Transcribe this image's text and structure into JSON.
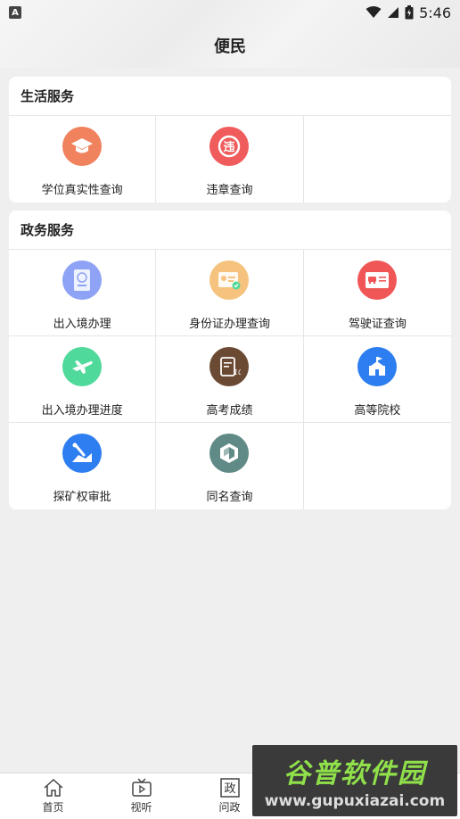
{
  "status_bar": {
    "app_indicator": "A",
    "time": "5:46",
    "icons": [
      "wifi-icon",
      "signal-icon",
      "battery-icon"
    ]
  },
  "header": {
    "title": "便民"
  },
  "sections": [
    {
      "title": "生活服务",
      "items": [
        {
          "label": "学位真实性查询",
          "icon": "graduation-cap-icon",
          "color": "#f0825e"
        },
        {
          "label": "违章查询",
          "icon": "traffic-violation-icon",
          "color": "#f05b5b"
        }
      ]
    },
    {
      "title": "政务服务",
      "items": [
        {
          "label": "出入境办理",
          "icon": "passport-icon",
          "color": "#8ea3f5"
        },
        {
          "label": "身份证办理查询",
          "icon": "id-card-icon",
          "color": "#f5c37d"
        },
        {
          "label": "驾驶证查询",
          "icon": "driver-license-icon",
          "color": "#f05656"
        },
        {
          "label": "出入境办理进度",
          "icon": "airplane-icon",
          "color": "#4fd99a"
        },
        {
          "label": "高考成绩",
          "icon": "exam-score-icon",
          "color": "#6b4a34"
        },
        {
          "label": "高等院校",
          "icon": "university-icon",
          "color": "#2d7ef0"
        },
        {
          "label": "探矿权审批",
          "icon": "mining-icon",
          "color": "#2d7ef0"
        },
        {
          "label": "同名查询",
          "icon": "name-search-icon",
          "color": "#5f8a86"
        }
      ]
    }
  ],
  "tabbar": {
    "tabs": [
      {
        "label": "首页",
        "icon": "home-icon"
      },
      {
        "label": "视听",
        "icon": "tv-icon"
      },
      {
        "label": "问政",
        "icon": "politics-icon",
        "glyph": "政"
      }
    ]
  },
  "watermark": {
    "main": "谷普软件园",
    "sub": "www.gupuxiazai.com"
  }
}
